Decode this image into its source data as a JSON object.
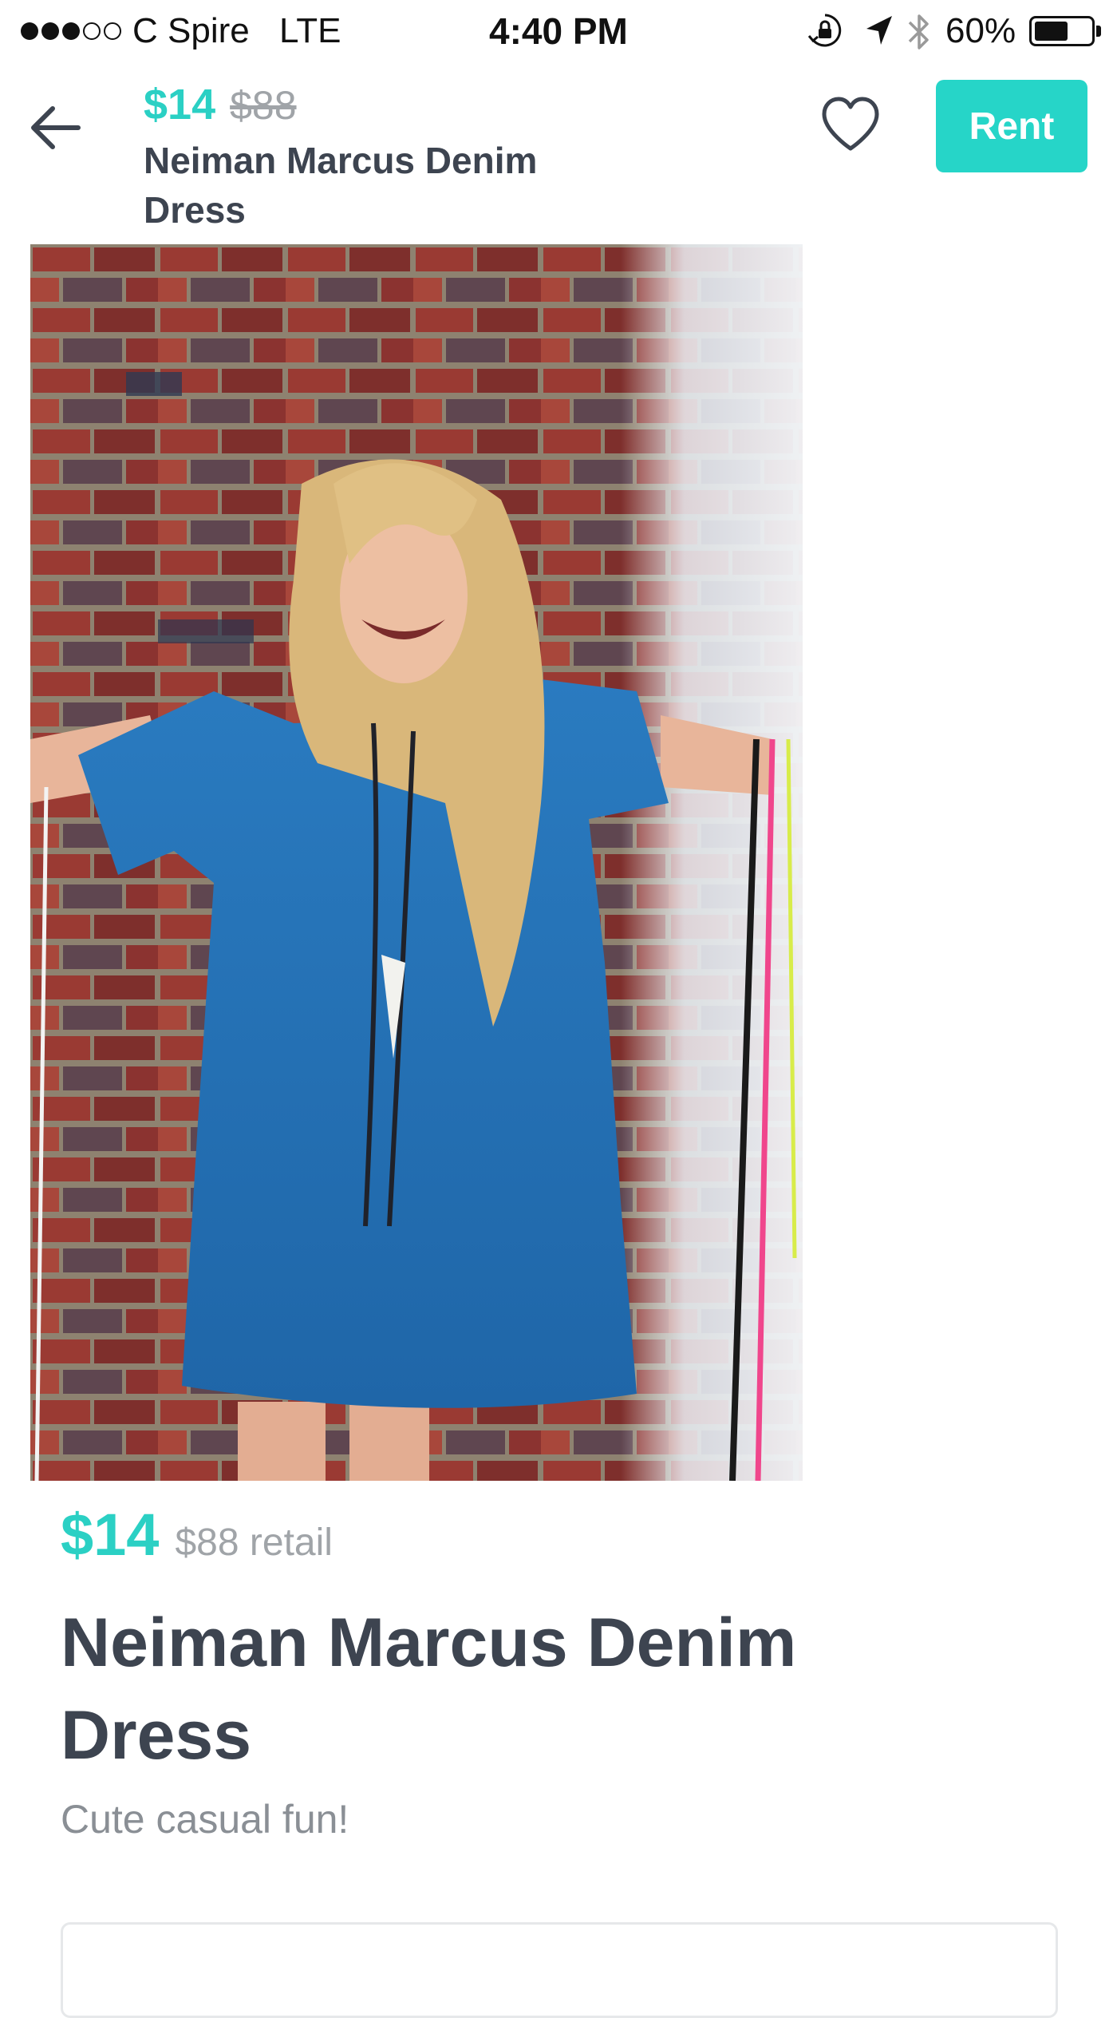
{
  "status_bar": {
    "carrier": "C Spire",
    "network": "LTE",
    "time": "4:40 PM",
    "battery_text": "60%",
    "battery_level": 0.6,
    "signal_bars_filled": 3,
    "signal_bars_total": 5,
    "icons": [
      "orientation-lock-icon",
      "location-arrow-icon",
      "bluetooth-icon",
      "battery-icon"
    ]
  },
  "header": {
    "back_icon": "arrow-left-icon",
    "price": "$14",
    "original_price": "$88",
    "title": "Neiman Marcus Denim Dress",
    "favorite_icon": "heart-outline-icon",
    "rent_label": "Rent"
  },
  "product": {
    "price": "$14",
    "retail": "$88 retail",
    "title": "Neiman Marcus Denim Dress",
    "description": "Cute casual fun!"
  },
  "colors": {
    "accent": "#26d5c8",
    "price_accent": "#2bd0c4",
    "text_dark": "#3d4450",
    "text_muted": "#a0a4a8"
  }
}
